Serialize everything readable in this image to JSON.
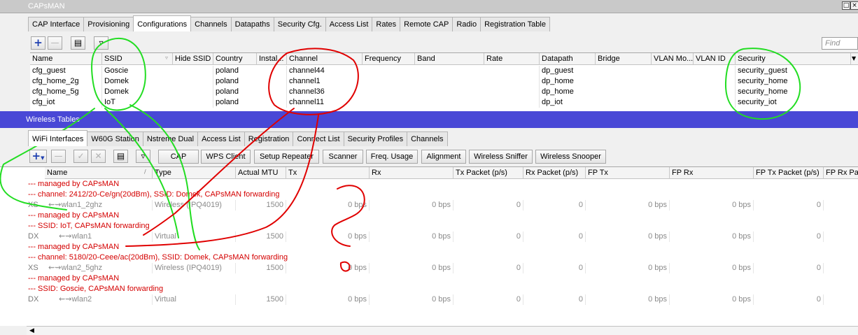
{
  "window": {
    "title": "CAPsMAN"
  },
  "capsman": {
    "tabs": [
      "CAP Interface",
      "Provisioning",
      "Configurations",
      "Channels",
      "Datapaths",
      "Security Cfg.",
      "Access List",
      "Rates",
      "Remote CAP",
      "Radio",
      "Registration Table"
    ],
    "active_tab": "Configurations",
    "find_placeholder": "Find",
    "columns": [
      "Name",
      "SSID",
      "Hide SSID",
      "Country",
      "Instal...",
      "Channel",
      "Frequency",
      "Band",
      "Rate",
      "Datapath",
      "Bridge",
      "VLAN Mo...",
      "VLAN ID",
      "Security"
    ],
    "rows": [
      {
        "name": "cfg_guest",
        "ssid": "Goscie",
        "country": "poland",
        "channel": "channel44",
        "datapath": "dp_guest",
        "security": "security_guest"
      },
      {
        "name": "cfg_home_2g",
        "ssid": "Domek",
        "country": "poland",
        "channel": "channel1",
        "datapath": "dp_home",
        "security": "security_home"
      },
      {
        "name": "cfg_home_5g",
        "ssid": "Domek",
        "country": "poland",
        "channel": "channel36",
        "datapath": "dp_home",
        "security": "security_home"
      },
      {
        "name": "cfg_iot",
        "ssid": "IoT",
        "country": "poland",
        "channel": "channel11",
        "datapath": "dp_iot",
        "security": "security_iot"
      }
    ]
  },
  "wireless": {
    "title": "Wireless Tables",
    "tabs": [
      "WiFi Interfaces",
      "W60G Station",
      "Nstreme Dual",
      "Access List",
      "Registration",
      "Connect List",
      "Security Profiles",
      "Channels"
    ],
    "active_tab": "WiFi Interfaces",
    "buttons": [
      "CAP",
      "WPS Client",
      "Setup Repeater",
      "Scanner",
      "Freq. Usage",
      "Alignment",
      "Wireless Sniffer",
      "Wireless Snooper"
    ],
    "columns": [
      "Name",
      "Type",
      "Actual MTU",
      "Tx",
      "Rx",
      "Tx Packet (p/s)",
      "Rx Packet (p/s)",
      "FP Tx",
      "FP Rx",
      "FP Tx Packet (p/s)",
      "FP Rx Pa"
    ],
    "rows": [
      {
        "comments": [
          "--- managed by CAPsMAN",
          "--- channel: 2412/20-Ce/gn(20dBm), SSID: Domek, CAPsMAN forwarding"
        ],
        "flag": "XS",
        "name": "wlan1_2ghz",
        "type": "Wireless (IPQ4019)",
        "mtu": "1500",
        "tx": "0 bps",
        "rx": "0 bps",
        "txp": "0",
        "rxp": "0",
        "fptx": "0 bps",
        "fprx": "0 bps",
        "fptxp": "0"
      },
      {
        "comments": [
          "--- managed by CAPsMAN",
          "--- SSID: IoT, CAPsMAN forwarding"
        ],
        "flag": "DX",
        "name": "wlan1",
        "type": "Virtual",
        "mtu": "1500",
        "tx": "0 bps",
        "rx": "0 bps",
        "txp": "0",
        "rxp": "0",
        "fptx": "0 bps",
        "fprx": "0 bps",
        "fptxp": "0"
      },
      {
        "comments": [
          "--- managed by CAPsMAN",
          "--- channel: 5180/20-Ceee/ac(20dBm), SSID: Domek, CAPsMAN forwarding"
        ],
        "flag": "XS",
        "name": "wlan2_5ghz",
        "type": "Wireless (IPQ4019)",
        "mtu": "1500",
        "tx": "0 bps",
        "rx": "0 bps",
        "txp": "0",
        "rxp": "0",
        "fptx": "0 bps",
        "fprx": "0 bps",
        "fptxp": "0"
      },
      {
        "comments": [
          "--- managed by CAPsMAN",
          "--- SSID: Goscie, CAPsMAN forwarding"
        ],
        "flag": "DX",
        "name": "wlan2",
        "type": "Virtual",
        "mtu": "1500",
        "tx": "0 bps",
        "rx": "0 bps",
        "txp": "0",
        "rxp": "0",
        "fptx": "0 bps",
        "fprx": "0 bps",
        "fptxp": "0"
      }
    ]
  },
  "icons": {
    "add": "plus-icon",
    "remove": "minus-icon",
    "enable": "check-icon",
    "disable": "cross-icon",
    "comment": "note-icon",
    "filter": "filter-icon",
    "sort": "sort-icon",
    "interface": "interface-arrows-icon",
    "restore": "window-restore-icon",
    "close": "window-close-icon",
    "scroll_left": "arrow-left-icon"
  },
  "colors": {
    "wireless_title_bar": "#4948d6",
    "comment_text": "#d40000",
    "annotation_green": "#22dd22",
    "annotation_red": "#e00000",
    "add_icon": "#1e3fb0"
  }
}
